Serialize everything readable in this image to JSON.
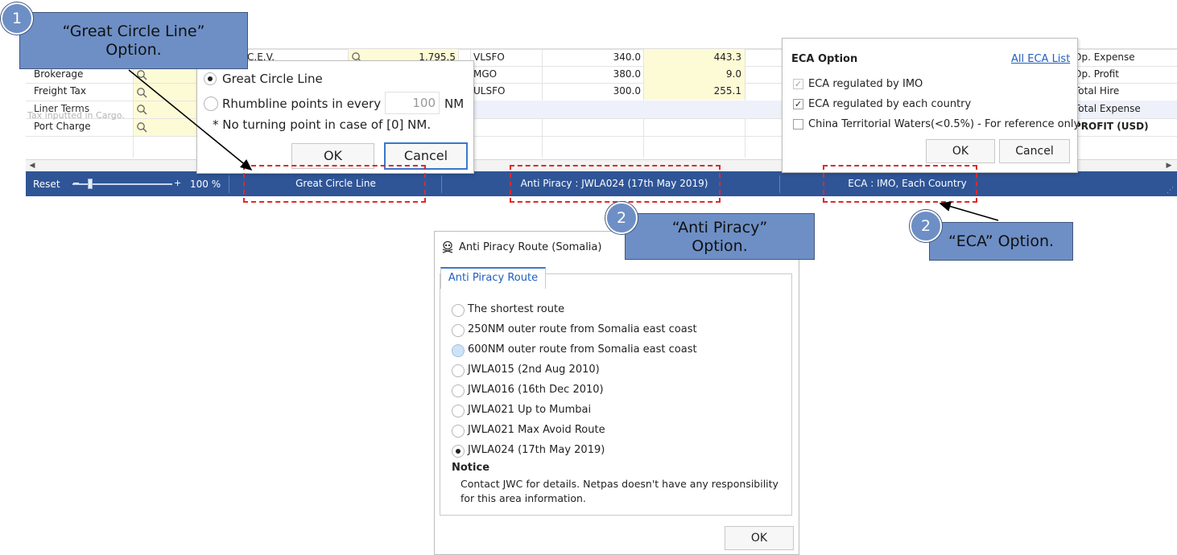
{
  "callouts": {
    "great_circle": {
      "badge": "1",
      "line1": "“Great Circle Line”",
      "line2": "Option."
    },
    "anti_piracy": {
      "badge": "2",
      "line1": "“Anti Piracy”",
      "line2": "Option."
    },
    "eca": {
      "badge": "2",
      "text": "“ECA” Option."
    }
  },
  "grid": {
    "left_labels": [
      "Brokerage",
      "Freight Tax",
      "Liner Terms",
      "Port Charge"
    ],
    "ghost_text": "Tax inputted in Cargo.",
    "cev_label": "C.E.V.",
    "cev_value": "1,795.5",
    "fuel_rows": [
      {
        "fuel": "VLSFO",
        "price": "340.0",
        "qty": "443.3"
      },
      {
        "fuel": "MGO",
        "price": "380.0",
        "qty": "9.0"
      },
      {
        "fuel": "ULSFO",
        "price": "300.0",
        "qty": "255.1"
      }
    ],
    "right_labels": [
      "Op. Expense",
      "Op. Profit",
      "Total Hire",
      "Total Expense",
      "PROFIT (USD)"
    ]
  },
  "statusbar": {
    "reset_label": "Reset",
    "zoom_value": "100 %",
    "zoom_fraction": 0.1,
    "great_circle": "Great Circle Line",
    "anti_piracy": "Anti Piracy : JWLA024 (17th May 2019)",
    "eca": "ECA : IMO, Each Country"
  },
  "gc_dialog": {
    "option_great_circle": "Great Circle Line",
    "option_rhumbline": "Rhumbline points in every",
    "rhumbline_value": "100",
    "rhumbline_unit": "NM",
    "note": "* No turning point in case of [0] NM.",
    "ok": "OK",
    "cancel": "Cancel",
    "selected": "great_circle"
  },
  "eca_dialog": {
    "title": "ECA Option",
    "link": "All ECA List",
    "options": [
      {
        "label": "ECA regulated by IMO",
        "checked": true,
        "disabled": true
      },
      {
        "label": "ECA regulated by each country",
        "checked": true,
        "disabled": false
      },
      {
        "label": "China Territorial Waters(<0.5%) - For reference only",
        "checked": false,
        "disabled": false
      }
    ],
    "ok": "OK",
    "cancel": "Cancel"
  },
  "ap_dialog": {
    "title": "Anti Piracy Route (Somalia)",
    "tab": "Anti Piracy Route",
    "routes": [
      "The shortest route",
      "250NM outer route from Somalia east coast",
      "600NM outer route from Somalia east coast",
      "JWLA015 (2nd Aug 2010)",
      "JWLA016 (16th Dec 2010)",
      "JWLA021 Up to Mumbai",
      "JWLA021 Max Avoid Route",
      "JWLA024 (17th May 2019)"
    ],
    "selected_index": 7,
    "hover_index": 2,
    "notice_title": "Notice",
    "notice_line1": "Contact JWC for details. Netpas doesn't have any responsibility",
    "notice_line2": "for this area information.",
    "ok": "OK"
  },
  "colors": {
    "statusbar": "#2f5597",
    "callout": "#6d8fc6",
    "dashed": "#e0292b",
    "input_yellow": "#fdfbd6",
    "link": "#1f5fbf"
  }
}
